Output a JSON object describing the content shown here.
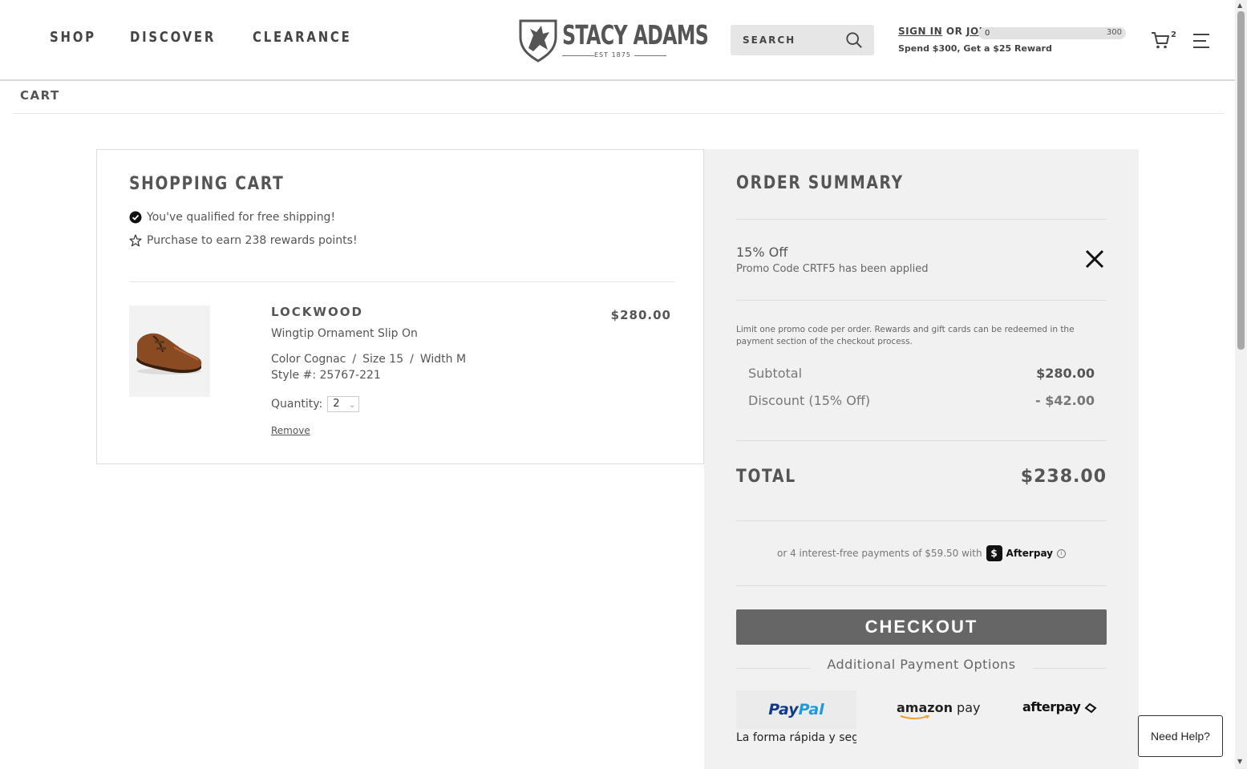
{
  "nav": {
    "shop": "SHOP",
    "discover": "DISCOVER",
    "clearance": "CLEARANCE"
  },
  "logo": {
    "name": "STACY ADAMS",
    "est": "EST 1875"
  },
  "search": {
    "placeholder": "SEARCH"
  },
  "account": {
    "sign_in": "SIGN IN",
    "or": "OR",
    "join": "JOIN",
    "reward_text": "Spend $300, Get a $25 Reward",
    "progress_min": "0",
    "progress_max": "300",
    "progress_fraction": 0.0
  },
  "cart_count": "2",
  "breadcrumb": "CART",
  "cart": {
    "title": "SHOPPING CART",
    "free_shipping": "You've qualified for free shipping!",
    "rewards": "Purchase to earn 238 rewards points!",
    "item": {
      "name": "LOCKWOOD",
      "subtitle": "Wingtip Ornament Slip On",
      "color": "Color Cognac",
      "size": "Size 15",
      "width": "Width M",
      "sep": "/",
      "style": "Style #: 25767-221",
      "quantity_label": "Quantity:",
      "quantity": "2",
      "remove": "Remove",
      "price": "$280.00"
    }
  },
  "summary": {
    "title": "ORDER SUMMARY",
    "promo_title": "15% Off",
    "promo_sub": "Promo Code CRTF5 has been applied",
    "limit_note": "Limit one promo code per order. Rewards and gift cards can be redeemed in the payment section of the checkout process.",
    "subtotal_label": "Subtotal",
    "subtotal_value": "$280.00",
    "discount_label": "Discount (15% Off)",
    "discount_value": "- $42.00",
    "total_label": "TOTAL",
    "total_value": "$238.00",
    "afterpay_text": "or 4 interest-free payments of $59.50 with",
    "afterpay_brand": "Afterpay",
    "afterpay_badge": "$",
    "afterpay_info": "i",
    "checkout": "CHECKOUT",
    "additional": "Additional Payment Options",
    "paypal_a": "Pay",
    "paypal_b": "Pal",
    "paypal_tag": "La forma rápida y seg",
    "amazon_a": "amazon",
    "amazon_b": " pay",
    "afterpay_logo": "afterpay"
  },
  "help": "Need Help?",
  "colors": {
    "checkout_bg": "#666666",
    "summary_bg": "#f1f1f1",
    "paypal_dark": "#123a8a",
    "paypal_light": "#1a9be0",
    "amazon_orange": "#f0a030"
  }
}
